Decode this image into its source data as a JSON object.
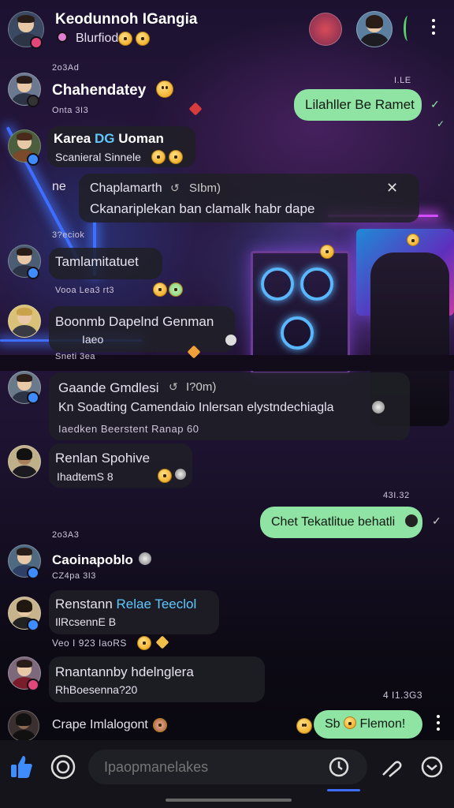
{
  "header": {
    "title": "Keodunnoh IGangia",
    "subtitle": "Blurfiod"
  },
  "messages": [
    {
      "date": "2o3Ad"
    },
    {
      "name": "Chahendatey",
      "meta": "Onta 3I3"
    },
    {
      "green_text": "Lilahller Be Ramet",
      "time": "I.LE"
    },
    {
      "name": "Karea",
      "name_accent": "DG",
      "name_rest": "Uoman",
      "text": "Scanieral Sinnele"
    },
    {
      "prefix": "ne",
      "name": "Chaplamarth",
      "time": "SIbm)",
      "text": "Ckanariplekan ban clamalk habr dape"
    },
    {
      "date": "3?eciok"
    },
    {
      "name": "Tamlamitatuet",
      "meta": "Vooa Lea3 rt3"
    },
    {
      "name": "Boonmb Dapelnd Genman",
      "text": "Iaeo",
      "meta": "Sneti 3ea"
    },
    {
      "name": "Gaande Gmdlesi",
      "time": "I?0m)",
      "text": "Kn Soadting Camendaio Inlersan elystndechiagla",
      "meta": "Iaedken Beerstent Ranap 60"
    },
    {
      "name": "Renlan Spohive",
      "text": "IhadtemS 8"
    },
    {
      "time": "43I.32"
    },
    {
      "green_text": "Chet Tekatlitue behatli"
    },
    {
      "date": "2o3A3"
    },
    {
      "name": "Caoinapoblo",
      "meta": "CZ4pa 3I3"
    },
    {
      "name": "Renstann",
      "name_accent": "Relae Teeclol",
      "text": "IlRcsennE B",
      "meta": "Veo I 923 IaoRS"
    },
    {
      "name": "Rnantannby hdelnglera",
      "text": "RhBoesenna?20"
    },
    {
      "time": "4 I1.3G3"
    },
    {
      "name": "Crape Imlalogont"
    },
    {
      "green_text": "Sb",
      "green_rest": "Flemon!"
    }
  ],
  "composer": {
    "placeholder": "Ipaopmanelakes"
  },
  "icons": {
    "like": "thumbs-up-icon",
    "camera": "camera-icon",
    "clock": "clock-icon",
    "attach": "pin-icon",
    "send": "send-icon",
    "more": "more-vertical-icon"
  },
  "colors": {
    "accent_green": "#8fe3a3",
    "name_accent": "#5ec8ff",
    "like_blue": "#3f8cff"
  }
}
